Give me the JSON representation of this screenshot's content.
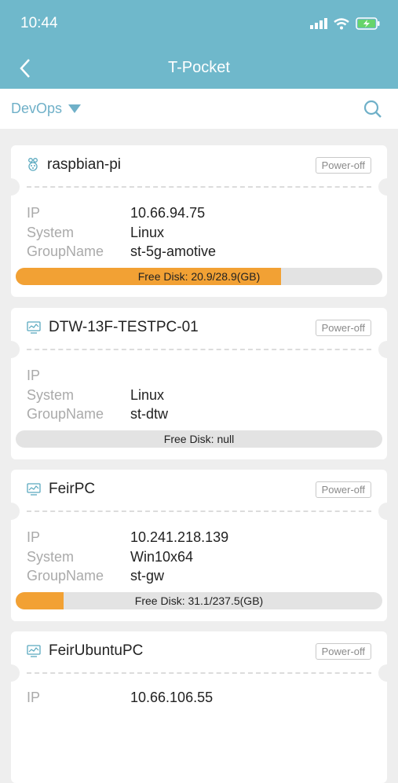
{
  "status": {
    "time": "10:44"
  },
  "nav": {
    "title": "T-Pocket"
  },
  "filter": {
    "group": "DevOps"
  },
  "devices": [
    {
      "icon": "raspberry-pi-icon",
      "name": "raspbian-pi",
      "state": "Power-off",
      "ip": "10.66.94.75",
      "system": "Linux",
      "group": "st-5g-amotive",
      "disk": "Free Disk: 20.9/28.9(GB)",
      "disk_fraction": 0.723
    },
    {
      "icon": "monitor-icon",
      "name": "DTW-13F-TESTPC-01",
      "state": "Power-off",
      "ip": "",
      "system": "Linux",
      "group": "st-dtw",
      "disk": "Free Disk: null",
      "disk_fraction": 0
    },
    {
      "icon": "monitor-icon",
      "name": "FeirPC",
      "state": "Power-off",
      "ip": "10.241.218.139",
      "system": "Win10x64",
      "group": "st-gw",
      "disk": "Free Disk: 31.1/237.5(GB)",
      "disk_fraction": 0.131
    },
    {
      "icon": "monitor-icon",
      "name": "FeirUbuntuPC",
      "state": "Power-off",
      "ip": "10.66.106.55",
      "system": "",
      "group": "",
      "disk": "",
      "disk_fraction": 0
    }
  ],
  "labels": {
    "ip": "IP",
    "system": "System",
    "group": "GroupName"
  },
  "colors": {
    "header": "#6fb8cb",
    "accent": "#6fb0c8",
    "disk_fill": "#f2a134"
  }
}
